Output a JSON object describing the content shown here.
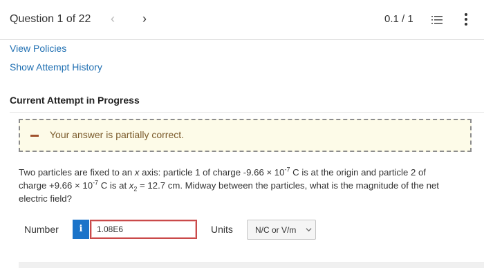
{
  "header": {
    "question_label": "Question 1 of 22",
    "prev_icon": "chevron-left-icon",
    "next_icon": "chevron-right-icon",
    "score": "0.1 / 1",
    "list_icon": "numbered-list-icon",
    "more_icon": "more-vertical-icon"
  },
  "links": {
    "view_policies": "View Policies",
    "show_history": "Show Attempt History"
  },
  "attempt": {
    "heading": "Current Attempt in Progress"
  },
  "feedback": {
    "icon": "minus-icon",
    "text": "Your answer is partially correct.",
    "bg_color": "#fdfbe8",
    "text_color": "#7a5a2a"
  },
  "question": {
    "l1a": "Two particles are fixed to an ",
    "l1x": "x",
    "l1b": " axis: particle 1 of charge -9.66 × 10",
    "l1exp": "-7",
    "l1c": " C is at the origin and particle 2 of",
    "l2a": "charge +9.66 × 10",
    "l2exp": "-7",
    "l2b": " C is at ",
    "l2x": "x",
    "l2sub": "2",
    "l2c": " = 12.7 cm. Midway between the particles, what is the magnitude of the net",
    "l3": "electric field?"
  },
  "answer": {
    "number_label": "Number",
    "info_label": "i",
    "value": "1.08E6",
    "units_label": "Units",
    "unit_selected": "N/C or V/m",
    "accent_color": "#1a73c9",
    "error_color": "#c94a4a"
  }
}
